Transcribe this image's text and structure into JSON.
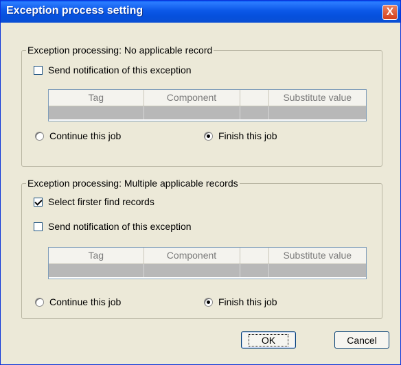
{
  "window": {
    "title": "Exception process setting",
    "close_glyph": "X"
  },
  "group1": {
    "legend": "Exception processing: No applicable record",
    "send_notification": {
      "label": "Send notification of this exception",
      "checked": false
    },
    "table": {
      "columns": [
        "Tag",
        "Component",
        "",
        "Substitute value"
      ]
    },
    "continue_radio": {
      "label": "Continue this job",
      "selected": false
    },
    "finish_radio": {
      "label": "Finish this job",
      "selected": true
    }
  },
  "group2": {
    "legend": "Exception processing: Multiple applicable records",
    "select_first": {
      "label": "Select firster find records",
      "checked": true
    },
    "send_notification": {
      "label": "Send notification of this exception",
      "checked": false
    },
    "table": {
      "columns": [
        "Tag",
        "Component",
        "",
        "Substitute value"
      ]
    },
    "continue_radio": {
      "label": "Continue this job",
      "selected": false
    },
    "finish_radio": {
      "label": "Finish this job",
      "selected": true
    }
  },
  "buttons": {
    "ok": "OK",
    "cancel": "Cancel"
  },
  "colors": {
    "titlebar": "#0a5bf4",
    "dialog_bg": "#ece9d8",
    "close": "#d4401c"
  }
}
